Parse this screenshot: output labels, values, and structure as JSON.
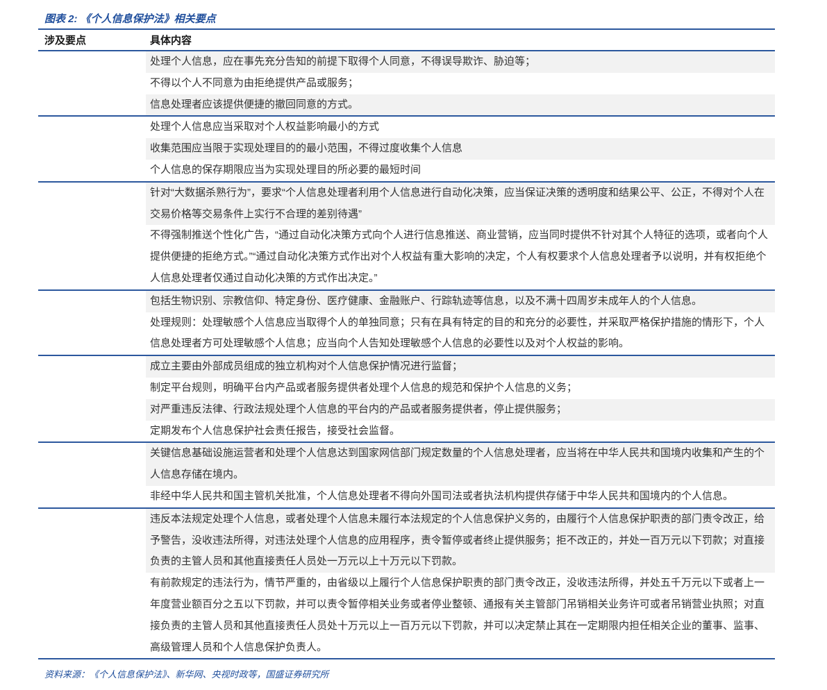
{
  "title": "图表 2: 《个人信息保护法》相关要点",
  "source": "资料来源：《个人信息保护法》、新华网、央视时政等，国盛证券研究所",
  "colors": {
    "rule_blue": "#2b579d",
    "title_blue": "#1f4e9c",
    "row_shade_gray": "#f2f2f2",
    "body_text": "#333333"
  },
  "table": {
    "headers": [
      "涉及要点",
      "具体内容"
    ],
    "groups": [
      {
        "label": "",
        "items": [
          {
            "text": "处理个人信息，应在事先充分告知的前提下取得个人同意，不得误导欺诈、胁迫等；",
            "lines": 1
          },
          {
            "text": "不得以个人不同意为由拒绝提供产品或服务；",
            "lines": 1
          },
          {
            "text": "信息处理者应该提供便捷的撤回同意的方式。",
            "lines": 1
          }
        ]
      },
      {
        "label": "",
        "items": [
          {
            "text": "处理个人信息应当采取对个人权益影响最小的方式",
            "lines": 1
          },
          {
            "text": "收集范围应当限于实现处理目的的最小范围，不得过度收集个人信息",
            "lines": 1
          },
          {
            "text": "个人信息的保存期限应当为实现处理目的所必要的最短时间",
            "lines": 1
          }
        ]
      },
      {
        "label": "",
        "items": [
          {
            "text": "针对“大数据杀熟行为”，要求“个人信息处理者利用个人信息进行自动化决策，应当保证决策的透明度和结果公平、公正，不得对个人在交易价格等交易条件上实行不合理的差别待遇”",
            "lines": 2
          },
          {
            "text": "不得强制推送个性化广告，“通过自动化决策方式向个人进行信息推送、商业营销，应当同时提供不针对其个人特征的选项，或者向个人提供便捷的拒绝方式。”“通过自动化决策方式作出对个人权益有重大影响的决定，个人有权要求个人信息处理者予以说明，并有权拒绝个人信息处理者仅通过自动化决策的方式作出决定。”",
            "lines": 3
          }
        ]
      },
      {
        "label": "",
        "items": [
          {
            "text": "包括生物识别、宗教信仰、特定身份、医疗健康、金融账户、行踪轨迹等信息，以及不满十四周岁未成年人的个人信息。",
            "lines": 1
          },
          {
            "text": "处理规则：处理敏感个人信息应当取得个人的单独同意；只有在具有特定的目的和充分的必要性，并采取严格保护措施的情形下，个人信息处理者方可处理敏感个人信息；应当向个人告知处理敏感个人信息的必要性以及对个人权益的影响。",
            "lines": 2
          }
        ]
      },
      {
        "label": "",
        "items": [
          {
            "text": "成立主要由外部成员组成的独立机构对个人信息保护情况进行监督；",
            "lines": 1
          },
          {
            "text": "制定平台规则，明确平台内产品或者服务提供者处理个人信息的规范和保护个人信息的义务；",
            "lines": 1
          },
          {
            "text": "对严重违反法律、行政法规处理个人信息的平台内的产品或者服务提供者，停止提供服务；",
            "lines": 1
          },
          {
            "text": "定期发布个人信息保护社会责任报告，接受社会监督。",
            "lines": 1
          }
        ]
      },
      {
        "label": "",
        "items": [
          {
            "text": "关键信息基础设施运营者和处理个人信息达到国家网信部门规定数量的个人信息处理者，应当将在中华人民共和国境内收集和产生的个人信息存储在境内。",
            "lines": 2
          },
          {
            "text": "非经中华人民共和国主管机关批准，个人信息处理者不得向外国司法或者执法机构提供存储于中华人民共和国境内的个人信息。",
            "lines": 1
          }
        ]
      },
      {
        "label": "",
        "items": [
          {
            "text": "违反本法规定处理个人信息，或者处理个人信息未履行本法规定的个人信息保护义务的，由履行个人信息保护职责的部门责令改正，给予警告，没收违法所得，对违法处理个人信息的应用程序，责令暂停或者终止提供服务；拒不改正的，并处一百万元以下罚款；对直接负责的主管人员和其他直接责任人员处一万元以上十万元以下罚款。",
            "lines": 3
          },
          {
            "text": "有前款规定的违法行为，情节严重的，由省级以上履行个人信息保护职责的部门责令改正，没收违法所得，并处五千万元以下或者上一年度营业额百分之五以下罚款，并可以责令暂停相关业务或者停业整顿、通报有关主管部门吊销相关业务许可或者吊销营业执照；对直接负责的主管人员和其他直接责任人员处十万元以上一百万元以下罚款，并可以决定禁止其在一定期限内担任相关企业的董事、监事、高级管理人员和个人信息保护负责人。",
            "lines": 4
          }
        ]
      }
    ]
  }
}
